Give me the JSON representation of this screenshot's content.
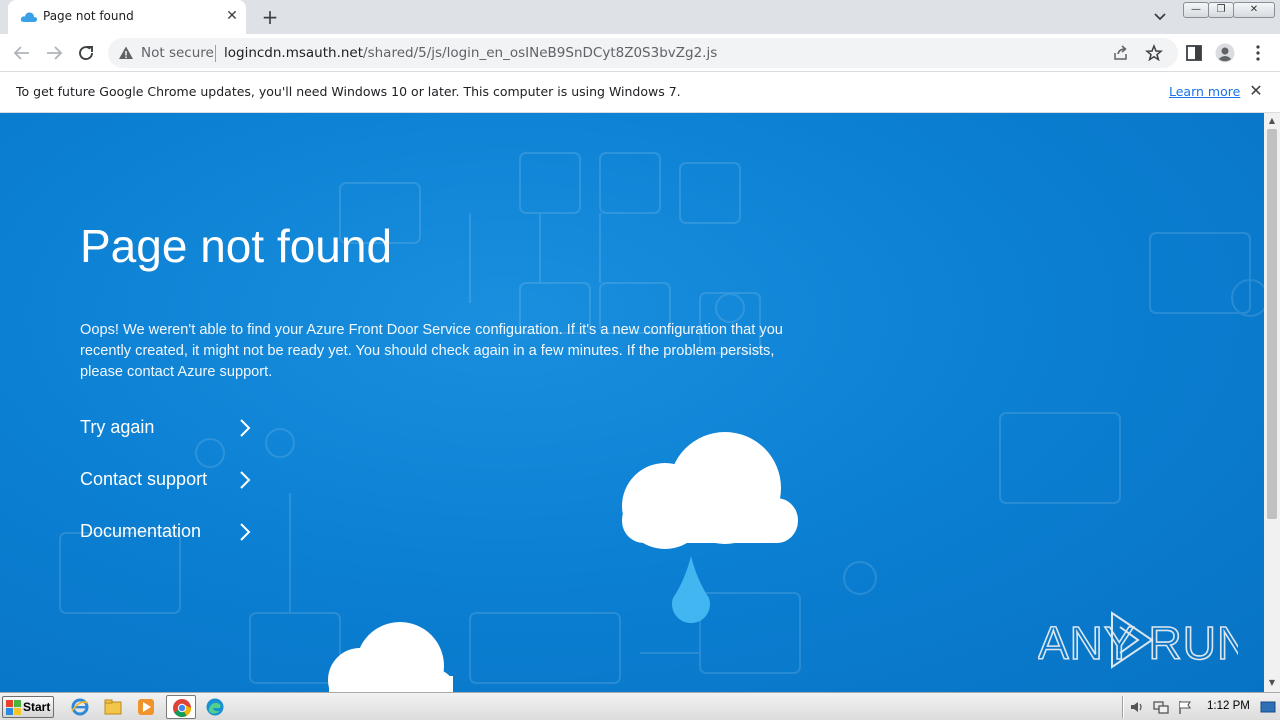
{
  "tab": {
    "title": "Page not found",
    "close_glyph": "✕",
    "newtab_glyph": "+"
  },
  "window_controls": {
    "minimize": "—",
    "maximize": "❐",
    "close": "✕"
  },
  "toolbar": {
    "security_label": "Not secure",
    "url_host": "logincdn.msauth.net",
    "url_path": "/shared/5/js/login_en_osINeB9SnDCyt8Z0S3bvZg2.js"
  },
  "infobar": {
    "message": "To get future Google Chrome updates, you'll need Windows 10 or later. This computer is using Windows 7.",
    "learn_more": "Learn more",
    "close_glyph": "✕"
  },
  "page": {
    "title": "Page not found",
    "description": "Oops! We weren't able to find your Azure Front Door Service configuration. If it's a new configuration that you recently created, it might not be ready yet. You should check again in a few minutes. If the problem persists, please contact Azure support.",
    "links": [
      {
        "label": "Try again"
      },
      {
        "label": "Contact support"
      },
      {
        "label": "Documentation"
      }
    ],
    "colors": {
      "background": "#0b7fd2",
      "text": "#ffffff",
      "drop": "#41b6f0"
    }
  },
  "watermark": {
    "text": "ANY RUN"
  },
  "scrollbar": {
    "up": "▲",
    "down": "▼"
  },
  "taskbar": {
    "start_label": "Start",
    "clock": "1:12 PM",
    "apps": [
      "internet-explorer-icon",
      "file-explorer-icon",
      "media-player-icon",
      "chrome-icon",
      "edge-icon"
    ]
  }
}
